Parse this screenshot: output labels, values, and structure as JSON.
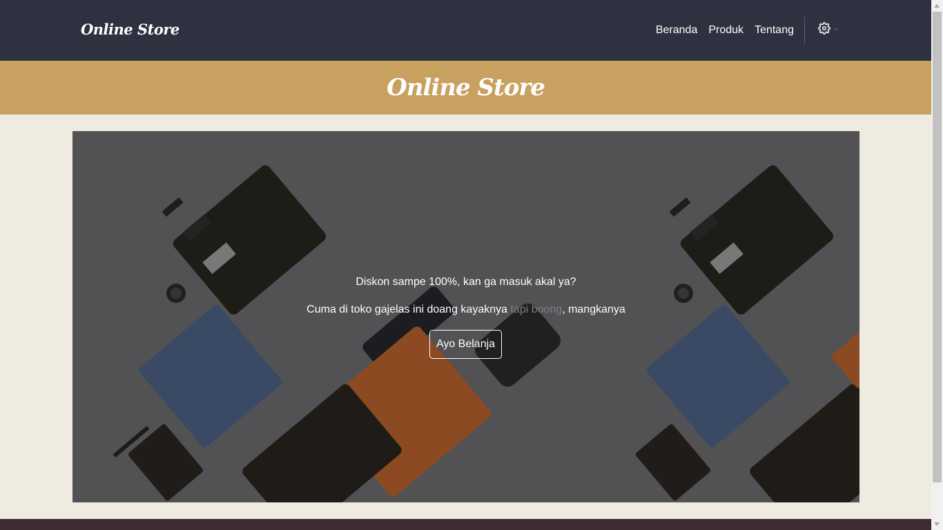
{
  "navbar": {
    "brand": "Online Store",
    "links": [
      {
        "label": "Beranda"
      },
      {
        "label": "Produk"
      },
      {
        "label": "Tentang"
      }
    ],
    "settings_icon": "gear-icon"
  },
  "banner": {
    "title": "Online Store"
  },
  "hero": {
    "line1": "Diskon sampe 100%, kan ga masuk akal ya?",
    "line2_before": "Cuma di toko gajelas ini doang kayaknya ",
    "line2_muted": "tapi boong",
    "line2_after": ", mangkanya",
    "cta_label": "Ayo Belanja"
  },
  "colors": {
    "navbar_bg": "#2e3240",
    "banner_bg": "#c8a060",
    "page_bg": "#f0ebe0",
    "footer_bg": "#3e2c35"
  }
}
